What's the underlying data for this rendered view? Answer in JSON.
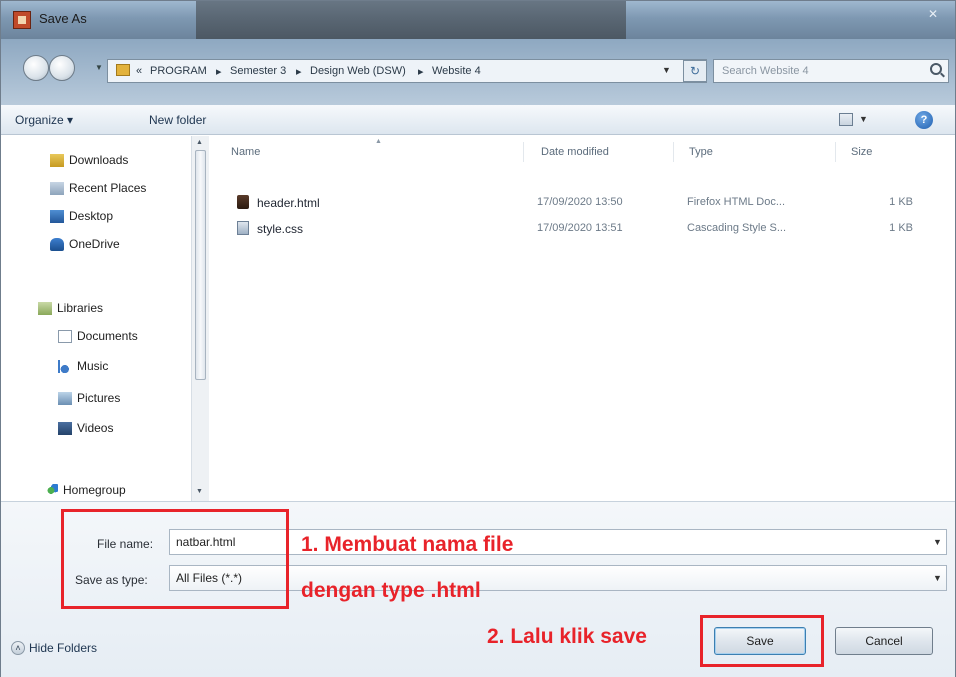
{
  "window": {
    "title": "Save As",
    "close_glyph": "✕"
  },
  "address": {
    "path_prefix": "«",
    "breadcrumbs": [
      "PROGRAM",
      "Semester 3",
      "Design Web (DSW)",
      "Website 4"
    ],
    "separator": "▸",
    "search_placeholder": "Search Website 4"
  },
  "toolbar": {
    "organize_label": "Organize ▾",
    "new_folder_label": "New folder",
    "help_label": "?"
  },
  "navigation": {
    "items": [
      {
        "label": "Downloads",
        "icon": "downloads-icon"
      },
      {
        "label": "Recent Places",
        "icon": "recent-places-icon"
      },
      {
        "label": "Desktop",
        "icon": "desktop-icon"
      },
      {
        "label": "OneDrive",
        "icon": "onedrive-icon"
      },
      {
        "label": "Libraries",
        "icon": "libraries-icon"
      },
      {
        "label": "Documents",
        "icon": "documents-icon"
      },
      {
        "label": "Music",
        "icon": "music-icon"
      },
      {
        "label": "Pictures",
        "icon": "pictures-icon"
      },
      {
        "label": "Videos",
        "icon": "videos-icon"
      },
      {
        "label": "Homegroup",
        "icon": "homegroup-icon"
      }
    ]
  },
  "file_list": {
    "columns": [
      "Name",
      "Date modified",
      "Type",
      "Size"
    ],
    "rows": [
      {
        "name": "header.html",
        "date_modified": "17/09/2020 13:50",
        "type": "Firefox HTML Doc...",
        "size": "1 KB",
        "icon": "html-file-icon"
      },
      {
        "name": "style.css",
        "date_modified": "17/09/2020 13:51",
        "type": "Cascading Style S...",
        "size": "1 KB",
        "icon": "css-file-icon"
      }
    ]
  },
  "save_panel": {
    "file_name_label": "File name:",
    "file_name_value": "natbar.html",
    "save_as_type_label": "Save as type:",
    "save_as_type_value": "All Files (*.*)",
    "hide_folders_label": "Hide Folders",
    "save_button": "Save",
    "cancel_button": "Cancel"
  },
  "annotations": {
    "step1_line1": "1. Membuat nama file",
    "step1_line2": "dengan type .html",
    "step2": "2. Lalu klik save",
    "color": "#e8232a"
  }
}
